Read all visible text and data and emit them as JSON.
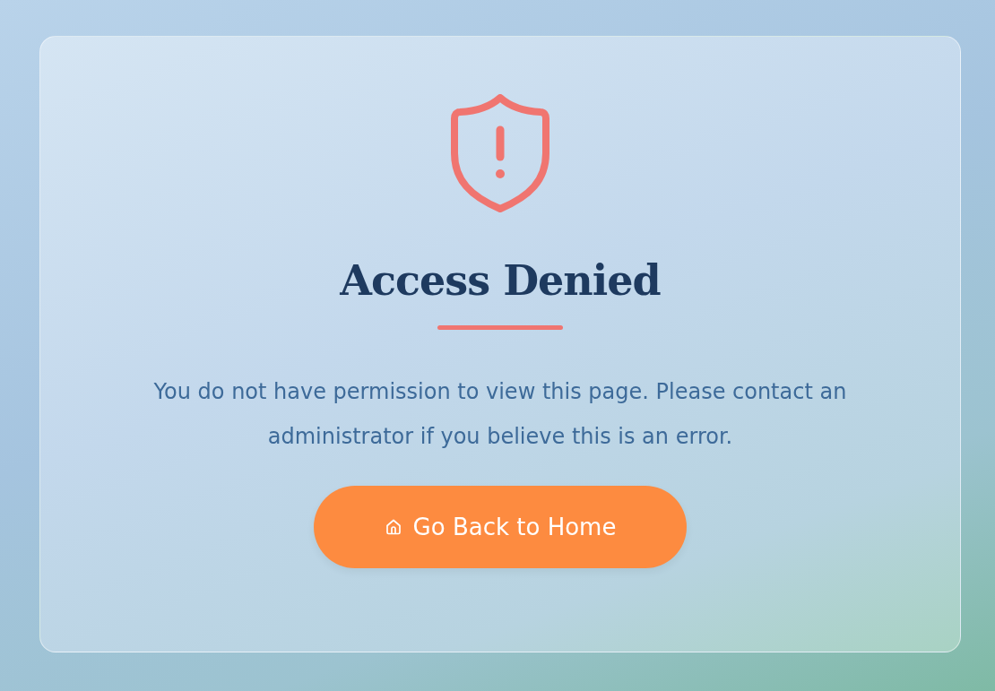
{
  "title": "Access Denied",
  "message": "You do not have permission to view this page. Please contact an administrator if you believe this is an error.",
  "button": {
    "label": "Go Back to Home"
  }
}
